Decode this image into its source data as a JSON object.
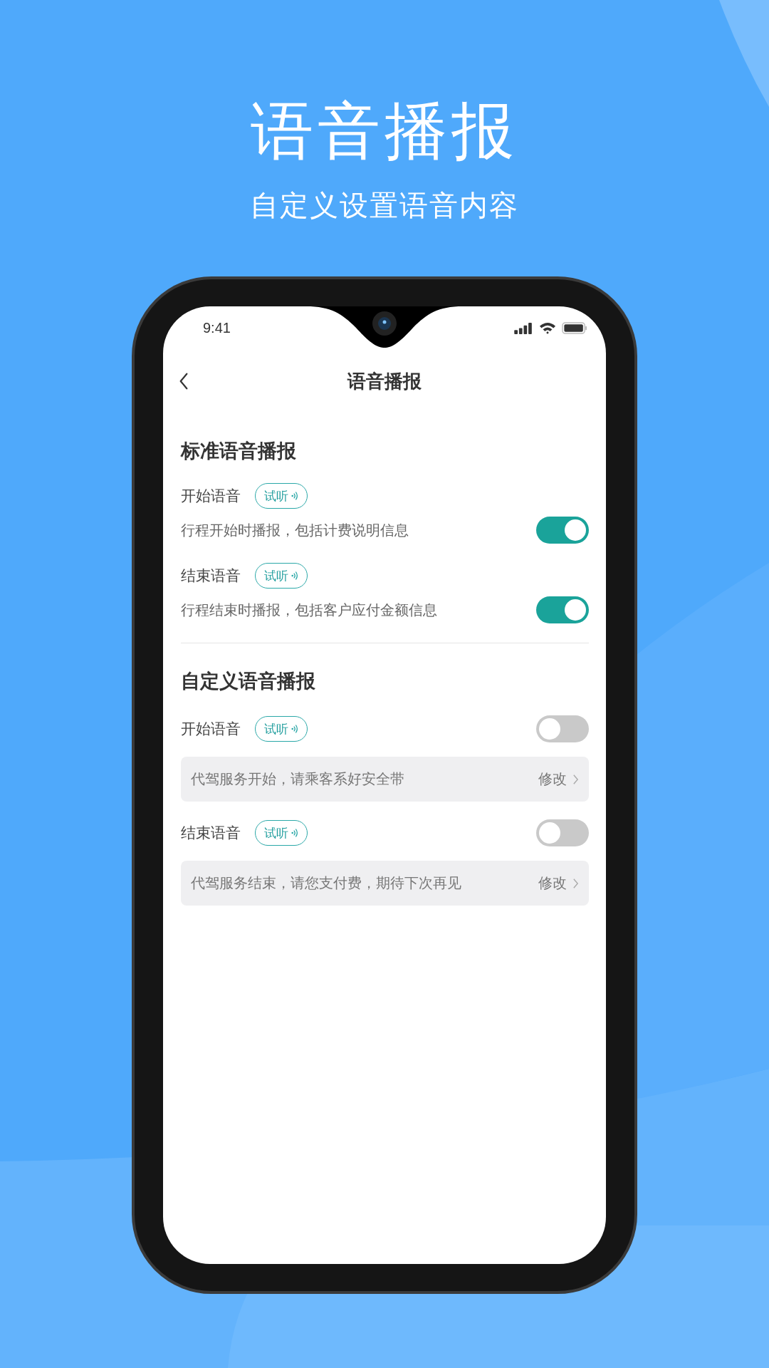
{
  "headline": "语音播报",
  "subtitle": "自定义设置语音内容",
  "status_bar": {
    "time": "9:41"
  },
  "nav": {
    "title": "语音播报"
  },
  "sections": [
    {
      "title": "标准语音播报",
      "items": [
        {
          "kind": "description",
          "label": "开始语音",
          "preview": "试听",
          "description": "行程开始时播报，包括计费说明信息",
          "on": true
        },
        {
          "kind": "description",
          "label": "结束语音",
          "preview": "试听",
          "description": "行程结束时播报，包括客户应付金额信息",
          "on": true
        }
      ]
    },
    {
      "title": "自定义语音播报",
      "items": [
        {
          "kind": "message",
          "label": "开始语音",
          "preview": "试听",
          "on": false,
          "message": "代驾服务开始，请乘客系好安全带",
          "edit": "修改"
        },
        {
          "kind": "message",
          "label": "结束语音",
          "preview": "试听",
          "on": false,
          "message": "代驾服务结束，请您支付费，期待下次再见",
          "edit": "修改"
        }
      ]
    }
  ]
}
